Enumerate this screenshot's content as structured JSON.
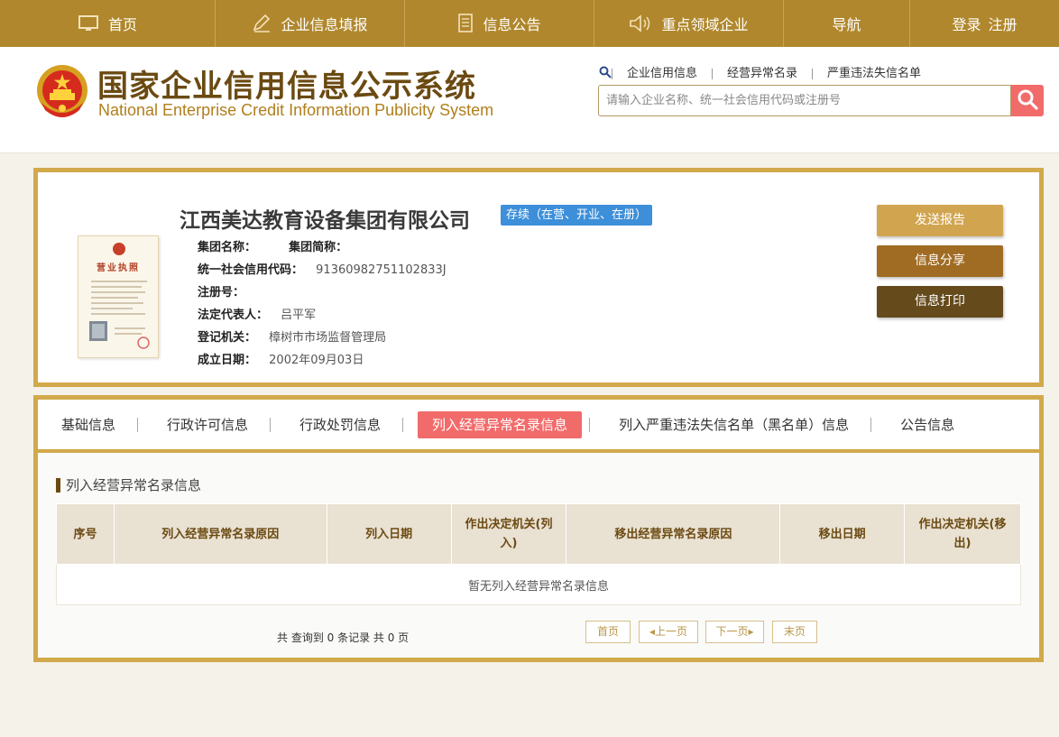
{
  "topnav": {
    "items": [
      {
        "label": "首页",
        "icon": "monitor-icon"
      },
      {
        "label": "企业信息填报",
        "icon": "edit-icon"
      },
      {
        "label": "信息公告",
        "icon": "document-icon"
      },
      {
        "label": "重点领域企业",
        "icon": "speaker-icon"
      },
      {
        "label": "导航"
      }
    ],
    "login": "登录",
    "register": "注册"
  },
  "header": {
    "title_cn": "国家企业信用信息公示系统",
    "title_en": "National Enterprise Credit Information Publicity System",
    "search_links": [
      "企业信用信息",
      "经营异常名录",
      "严重违法失信名单"
    ],
    "search_placeholder": "请输入企业名称、统一社会信用代码或注册号"
  },
  "company": {
    "name": "江西美达教育设备集团有限公司",
    "status": "存续（在营、开业、在册）",
    "license_title": "营业执照",
    "fields": {
      "group_name_label": "集团名称：",
      "group_short_label": "集团简称：",
      "credit_code_label": "统一社会信用代码：",
      "credit_code": "91360982751102833J",
      "reg_no_label": "注册号：",
      "legal_rep_label": "法定代表人：",
      "legal_rep": "吕平军",
      "authority_label": "登记机关：",
      "authority": "樟树市市场监督管理局",
      "founded_label": "成立日期：",
      "founded": "2002年09月03日"
    },
    "buttons": {
      "send_report": "发送报告",
      "share": "信息分享",
      "print": "信息打印"
    }
  },
  "tabs": [
    "基础信息",
    "行政许可信息",
    "行政处罚信息",
    "列入经营异常名录信息",
    "列入严重违法失信名单（黑名单）信息",
    "公告信息"
  ],
  "section": {
    "title": "列入经营异常名录信息",
    "columns": [
      "序号",
      "列入经营异常名录原因",
      "列入日期",
      "作出决定机关(列入)",
      "移出经营异常名录原因",
      "移出日期",
      "作出决定机关(移出)"
    ],
    "empty_text": "暂无列入经营异常名录信息"
  },
  "pager": {
    "summary": "共 查询到 0 条记录 共 0 页",
    "first": "首页",
    "prev": "上一页",
    "next": "下一页",
    "last": "末页"
  }
}
